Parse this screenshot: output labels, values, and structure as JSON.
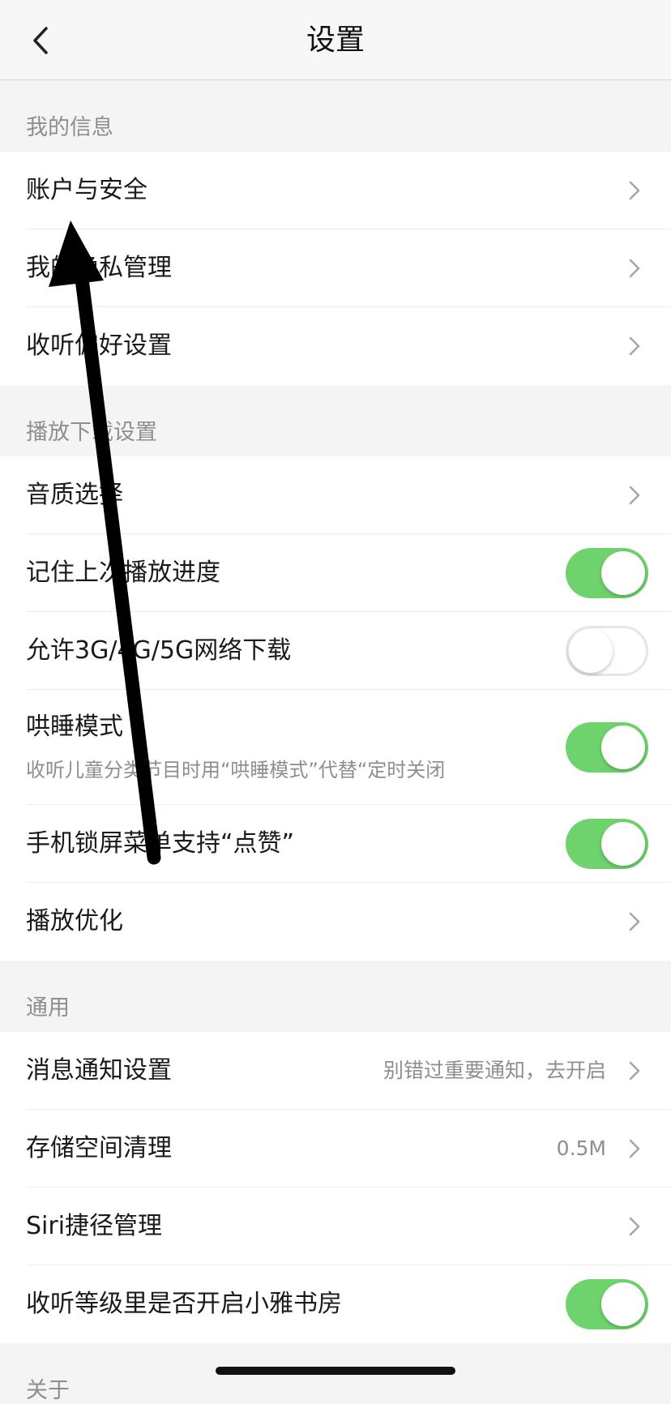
{
  "header": {
    "title": "设置",
    "back_icon": "chevron-left-icon"
  },
  "sections": [
    {
      "title": "我的信息",
      "rows": [
        {
          "label": "账户与安全",
          "control": "chevron"
        },
        {
          "label": "我的隐私管理",
          "control": "chevron"
        },
        {
          "label": "收听偏好设置",
          "control": "chevron"
        }
      ]
    },
    {
      "title": "播放下载设置",
      "rows": [
        {
          "label": "音质选择",
          "control": "chevron"
        },
        {
          "label": "记住上次播放进度",
          "control": "toggle",
          "on": true
        },
        {
          "label": "允许3G/4G/5G网络下载",
          "control": "toggle",
          "on": false
        },
        {
          "label": "哄睡模式",
          "sub": "收听儿童分类节目时用“哄睡模式”代替“定时关闭",
          "control": "toggle",
          "on": true
        },
        {
          "label": "手机锁屏菜单支持“点赞”",
          "control": "toggle",
          "on": true
        },
        {
          "label": "播放优化",
          "control": "chevron"
        }
      ]
    },
    {
      "title": "通用",
      "rows": [
        {
          "label": "消息通知设置",
          "value": "别错过重要通知，去开启",
          "control": "chevron"
        },
        {
          "label": "存储空间清理",
          "value": "0.5M",
          "control": "chevron"
        },
        {
          "label": "Siri捷径管理",
          "control": "chevron"
        },
        {
          "label": "收听等级里是否开启小雅书房",
          "control": "toggle",
          "on": true
        }
      ]
    },
    {
      "title": "关于",
      "rows": []
    }
  ],
  "colors": {
    "toggle_on": "#6fd36d",
    "accent_text": "#8e8e8e"
  },
  "annotation": {
    "type": "arrow",
    "color": "#000000",
    "points_to": "账户与安全"
  }
}
